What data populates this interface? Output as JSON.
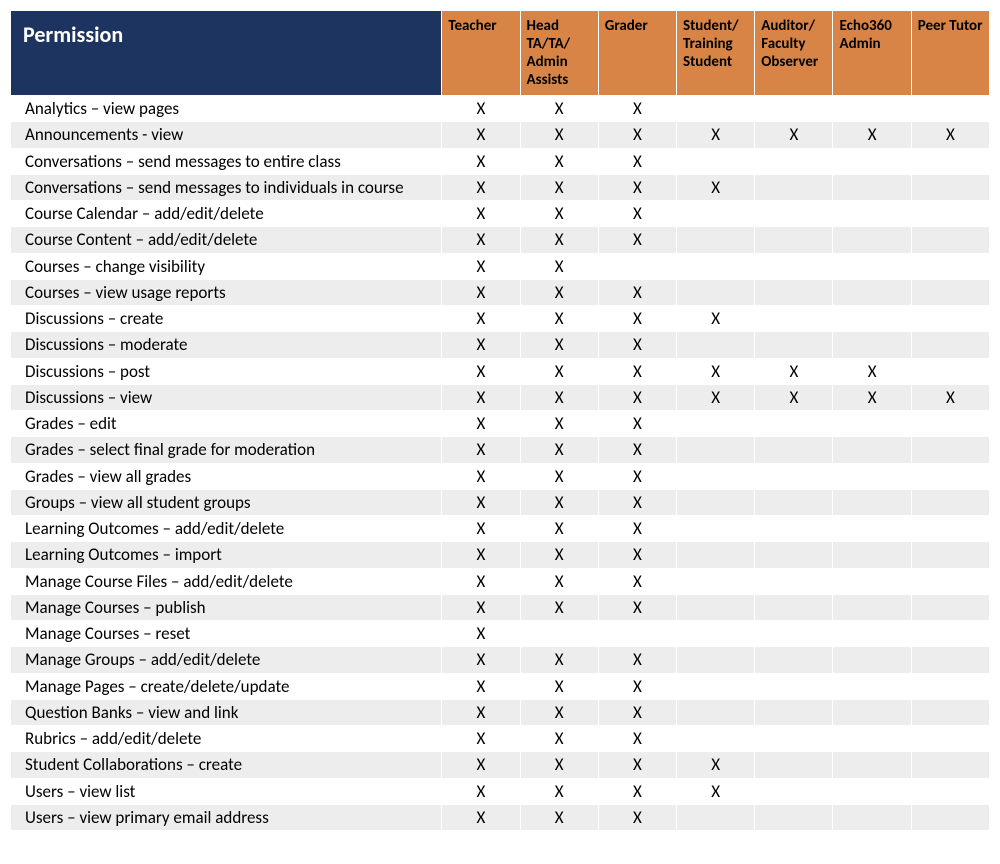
{
  "mark": "X",
  "header": {
    "corner": "Permission",
    "roles": [
      "Teacher",
      "Head TA/TA/ Admin Assists",
      "Grader",
      "Student/ Training Student",
      "Auditor/ Faculty Observer",
      "Echo360 Admin",
      "Peer Tutor"
    ]
  },
  "rows": [
    {
      "perm": "Analytics – view pages",
      "cells": [
        true,
        true,
        true,
        false,
        false,
        false,
        false
      ]
    },
    {
      "perm": "Announcements - view",
      "cells": [
        true,
        true,
        true,
        true,
        true,
        true,
        true
      ]
    },
    {
      "perm": "Conversations – send messages to entire class",
      "cells": [
        true,
        true,
        true,
        false,
        false,
        false,
        false
      ]
    },
    {
      "perm": "Conversations – send messages to individuals in course",
      "cells": [
        true,
        true,
        true,
        true,
        false,
        false,
        false
      ]
    },
    {
      "perm": "Course Calendar – add/edit/delete",
      "cells": [
        true,
        true,
        true,
        false,
        false,
        false,
        false
      ]
    },
    {
      "perm": "Course Content – add/edit/delete",
      "cells": [
        true,
        true,
        true,
        false,
        false,
        false,
        false
      ]
    },
    {
      "perm": "Courses – change visibility",
      "cells": [
        true,
        true,
        false,
        false,
        false,
        false,
        false
      ]
    },
    {
      "perm": "Courses – view usage reports",
      "cells": [
        true,
        true,
        true,
        false,
        false,
        false,
        false
      ]
    },
    {
      "perm": "Discussions – create",
      "cells": [
        true,
        true,
        true,
        true,
        false,
        false,
        false
      ]
    },
    {
      "perm": "Discussions – moderate",
      "cells": [
        true,
        true,
        true,
        false,
        false,
        false,
        false
      ]
    },
    {
      "perm": "Discussions – post",
      "cells": [
        true,
        true,
        true,
        true,
        true,
        true,
        false
      ]
    },
    {
      "perm": "Discussions – view",
      "cells": [
        true,
        true,
        true,
        true,
        true,
        true,
        true
      ]
    },
    {
      "perm": "Grades – edit",
      "cells": [
        true,
        true,
        true,
        false,
        false,
        false,
        false
      ]
    },
    {
      "perm": "Grades – select final grade for moderation",
      "cells": [
        true,
        true,
        true,
        false,
        false,
        false,
        false
      ]
    },
    {
      "perm": "Grades – view all grades",
      "cells": [
        true,
        true,
        true,
        false,
        false,
        false,
        false
      ]
    },
    {
      "perm": "Groups – view all student groups",
      "cells": [
        true,
        true,
        true,
        false,
        false,
        false,
        false
      ]
    },
    {
      "perm": "Learning Outcomes – add/edit/delete",
      "cells": [
        true,
        true,
        true,
        false,
        false,
        false,
        false
      ]
    },
    {
      "perm": "Learning Outcomes – import",
      "cells": [
        true,
        true,
        true,
        false,
        false,
        false,
        false
      ]
    },
    {
      "perm": "Manage Course Files – add/edit/delete",
      "cells": [
        true,
        true,
        true,
        false,
        false,
        false,
        false
      ]
    },
    {
      "perm": "Manage Courses – publish",
      "cells": [
        true,
        true,
        true,
        false,
        false,
        false,
        false
      ]
    },
    {
      "perm": "Manage Courses – reset",
      "cells": [
        true,
        false,
        false,
        false,
        false,
        false,
        false
      ]
    },
    {
      "perm": "Manage Groups – add/edit/delete",
      "cells": [
        true,
        true,
        true,
        false,
        false,
        false,
        false
      ]
    },
    {
      "perm": "Manage Pages – create/delete/update",
      "cells": [
        true,
        true,
        true,
        false,
        false,
        false,
        false
      ]
    },
    {
      "perm": "Question Banks – view and link",
      "cells": [
        true,
        true,
        true,
        false,
        false,
        false,
        false
      ]
    },
    {
      "perm": "Rubrics – add/edit/delete",
      "cells": [
        true,
        true,
        true,
        false,
        false,
        false,
        false
      ]
    },
    {
      "perm": "Student Collaborations – create",
      "cells": [
        true,
        true,
        true,
        true,
        false,
        false,
        false
      ]
    },
    {
      "perm": "Users – view list",
      "cells": [
        true,
        true,
        true,
        true,
        false,
        false,
        false
      ]
    },
    {
      "perm": "Users – view primary email address",
      "cells": [
        true,
        true,
        true,
        false,
        false,
        false,
        false
      ]
    }
  ]
}
